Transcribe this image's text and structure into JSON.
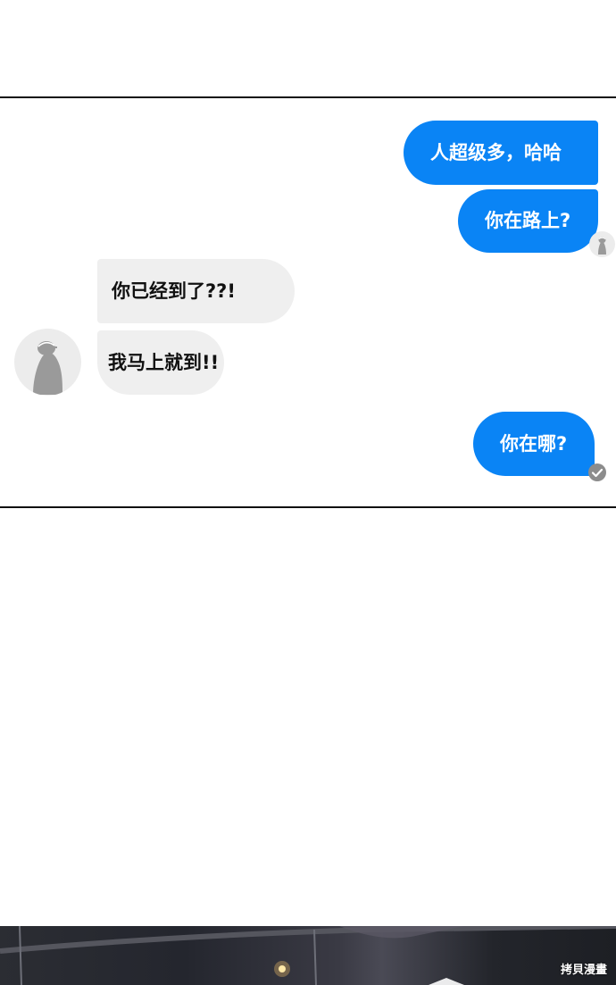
{
  "messages": [
    {
      "side": "out",
      "text": "人超级多，哈哈"
    },
    {
      "side": "out",
      "text": "你在路上?"
    },
    {
      "side": "in",
      "text": "你已经到了??!"
    },
    {
      "side": "in",
      "text": "我马上就到!!"
    },
    {
      "side": "out",
      "text": "你在哪?"
    }
  ],
  "watermark": "拷貝漫畫",
  "colors": {
    "outgoing_bubble": "#0a84f5",
    "incoming_bubble": "#efefef",
    "avatar_figure": "#9a9a9a"
  },
  "icons": {
    "read_receipt": "check-circle-icon",
    "contact_avatar": "avatar-icon"
  }
}
